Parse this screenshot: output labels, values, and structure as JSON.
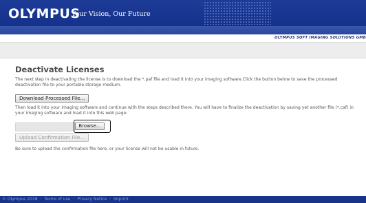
{
  "header": {
    "logo": "OLYMPUS",
    "tagline": "Your Vision, Our Future",
    "company": "OLYMPUS SOFT IMAGING SOLUTIONS GMB"
  },
  "main": {
    "title": "Deactivate Licenses",
    "paragraph1": "The next step in deactivating the license is to download the *.paf file and load it into your imaging software.Click the button below to save the processed deactivation file to your portable storage medium.",
    "download_button": "Download Processed File...",
    "paragraph2": "Then load it into your imaging software and continue with the steps described there. You will have to finalize the deactivation by saving yet another file (*.caf) in your imaging software and load it into this web page:",
    "browse_button": "Browse...",
    "upload_button": "Upload Confirmation File...",
    "paragraph3": "Be sure to upload the confirmation file here, or your license will not be usable in future."
  },
  "footer": {
    "copyright": "© Olympus 2018",
    "terms": "Terms of use",
    "privacy": "Privacy Notice",
    "imprint": "Imprint",
    "separator": "·"
  },
  "colors": {
    "header_blue": "#17348a",
    "text_gray": "#555555"
  }
}
